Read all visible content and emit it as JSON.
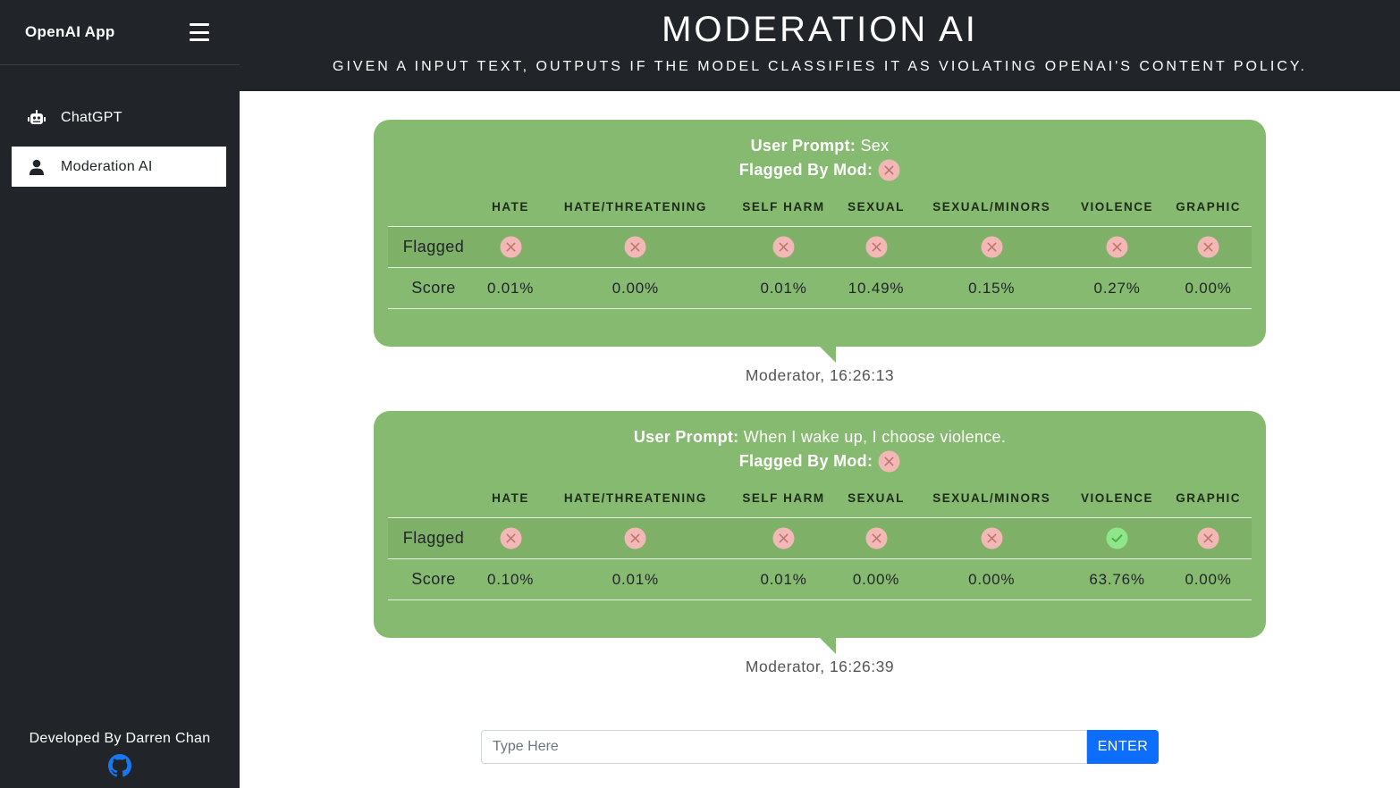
{
  "sidebar": {
    "brand": "OpenAI App",
    "items": [
      {
        "label": "ChatGPT",
        "icon": "robot-icon",
        "active": false
      },
      {
        "label": "Moderation AI",
        "icon": "user-icon",
        "active": true
      }
    ],
    "footer": "Developed By Darren Chan",
    "footer_icon": "github-icon"
  },
  "header": {
    "title": "MODERATION AI",
    "subtitle": "Given a input text, outputs if the model classifies it as violating OpenAI's content policy."
  },
  "columns": [
    "HATE",
    "HATE/THREATENING",
    "SELF HARM",
    "SEXUAL",
    "SEXUAL/MINORS",
    "VIOLENCE",
    "GRAPHIC"
  ],
  "labels": {
    "user_prompt": "User Prompt:",
    "flagged_by_mod": "Flagged By Mod:",
    "flagged_row": "Flagged",
    "score_row": "Score"
  },
  "messages": [
    {
      "prompt": "Sex",
      "flagged_by_mod": false,
      "flags": [
        false,
        false,
        false,
        false,
        false,
        false,
        false
      ],
      "scores": [
        "0.01%",
        "0.00%",
        "0.01%",
        "10.49%",
        "0.15%",
        "0.27%",
        "0.00%"
      ],
      "meta": "Moderator, 16:26:13"
    },
    {
      "prompt": "When I wake up, I choose violence.",
      "flagged_by_mod": false,
      "flags": [
        false,
        false,
        false,
        false,
        false,
        true,
        false
      ],
      "scores": [
        "0.10%",
        "0.01%",
        "0.01%",
        "0.00%",
        "0.00%",
        "63.76%",
        "0.00%"
      ],
      "meta": "Moderator, 16:26:39"
    }
  ],
  "input": {
    "placeholder": "Type Here",
    "value": "",
    "button": "ENTER"
  },
  "colors": {
    "sidebar_bg": "#212529",
    "bubble": "#87ba71",
    "flag_false_bg": "#f2b8b5",
    "flag_true_bg": "#8ee58a",
    "button": "#0d6efd"
  }
}
